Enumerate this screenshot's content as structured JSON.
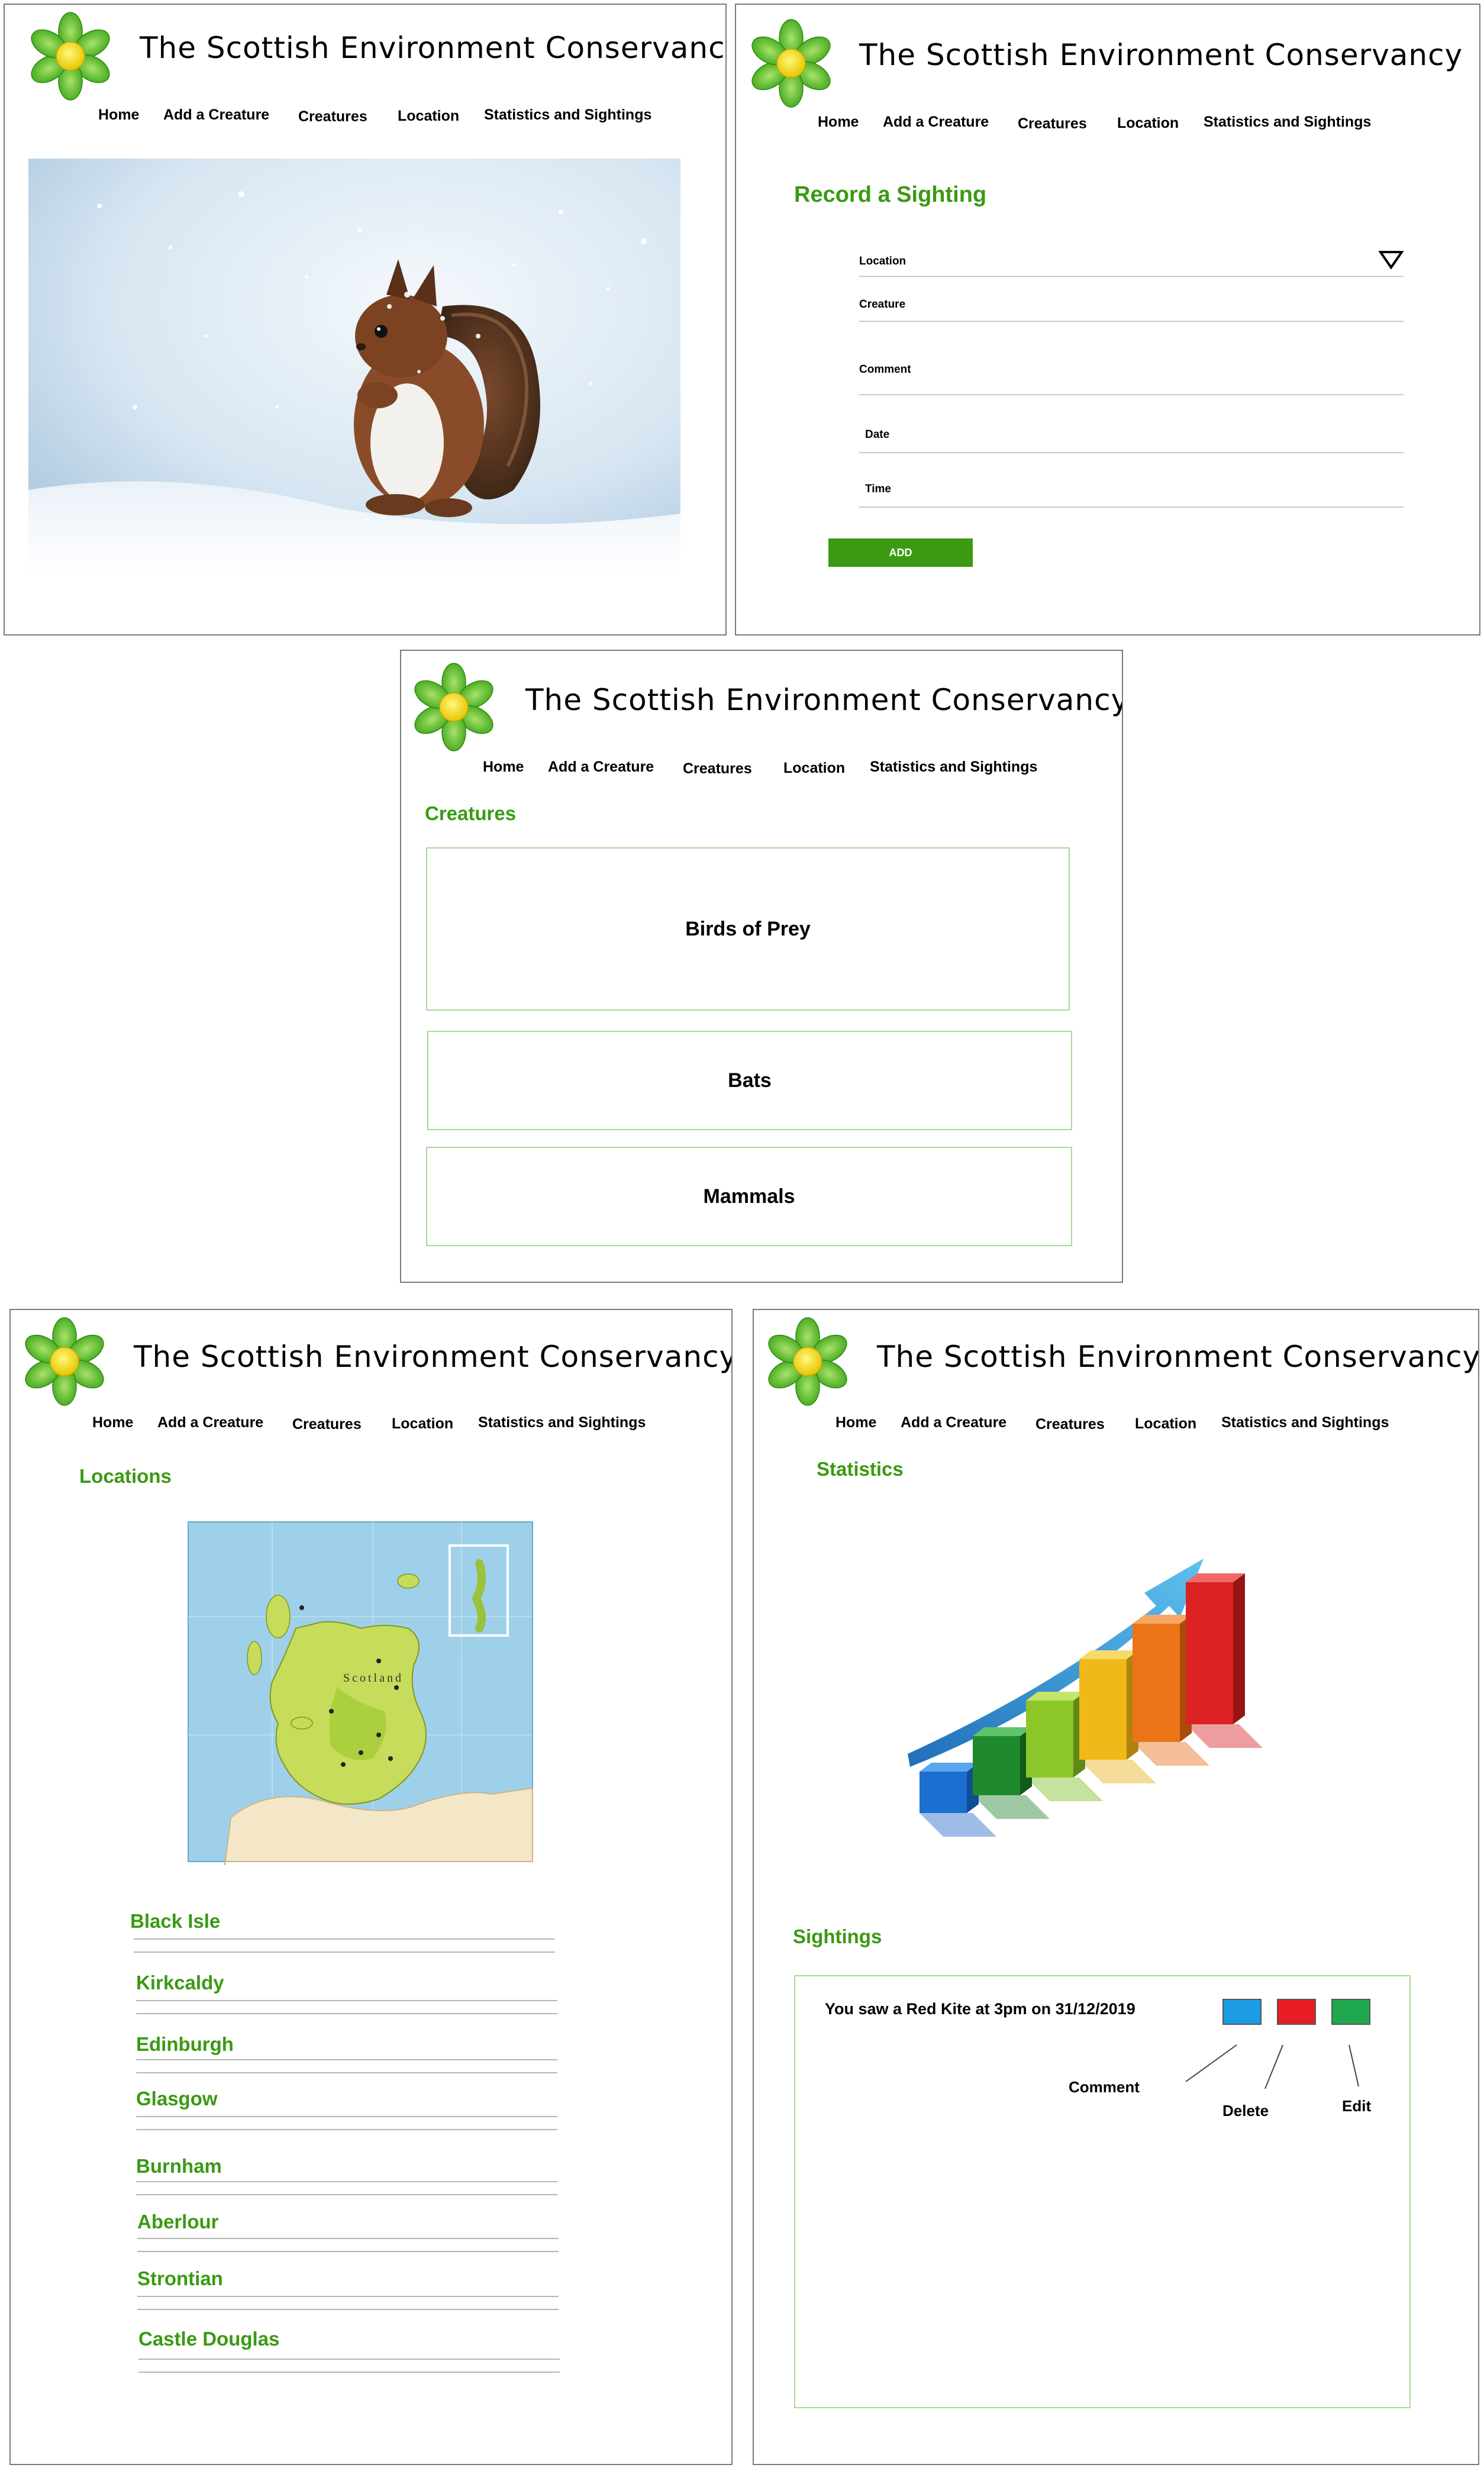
{
  "site": {
    "title": "The Scottish Environment Conservancy",
    "brand_green": "#3a9a12",
    "logo_icon": "flower-logo-icon"
  },
  "nav": {
    "home": "Home",
    "add_creature": "Add a Creature",
    "creatures": "Creatures",
    "location": "Location",
    "stats": "Statistics and Sightings"
  },
  "home": {
    "hero_image": "red-squirrel-in-snow-photo"
  },
  "record": {
    "heading": "Record a Sighting",
    "fields": {
      "location": "Location",
      "creature": "Creature",
      "comment": "Comment",
      "date": "Date",
      "time": "Time"
    },
    "add_label": "ADD"
  },
  "creatures": {
    "heading": "Creatures",
    "cards": [
      "Birds of Prey",
      "Bats",
      "Mammals"
    ]
  },
  "locations": {
    "heading": "Locations",
    "map_image": "scotland-map-image",
    "map_country_label": "Scotland",
    "items": [
      "Black Isle",
      "Kirkcaldy",
      "Edinburgh",
      "Glasgow",
      "Burnham",
      "Aberlour",
      "Strontian",
      "Castle Douglas"
    ]
  },
  "stats": {
    "heading": "Statistics",
    "chart_image": "3d-growth-bar-chart-image",
    "sightings_heading": "Sightings",
    "sighting_text": "You saw a Red Kite at 3pm on 31/12/2019",
    "button_colors": {
      "comment": "#1b9ce3",
      "delete": "#e81c24",
      "edit": "#1fa84d"
    },
    "callouts": {
      "comment": "Comment",
      "delete": "Delete",
      "edit": "Edit"
    }
  }
}
